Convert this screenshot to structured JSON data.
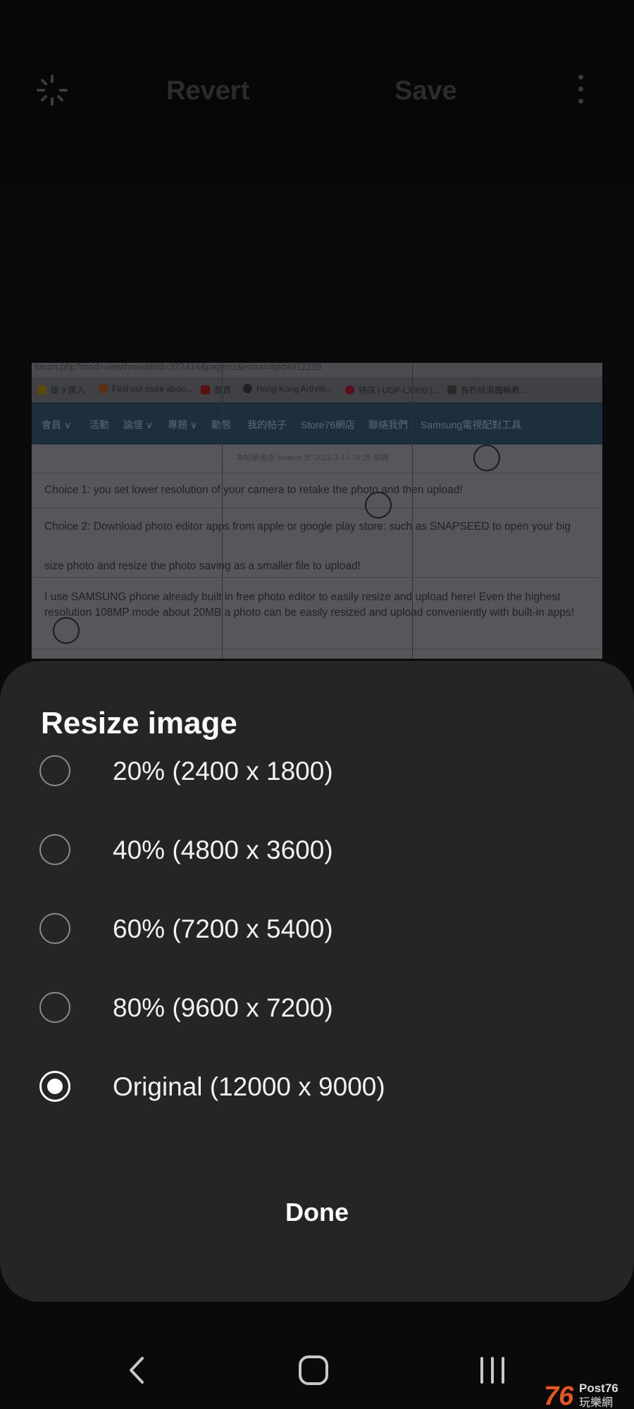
{
  "toolbar": {
    "revert_label": "Revert",
    "save_label": "Save",
    "icons": [
      "auto-adjust-icon",
      "more-options-icon"
    ]
  },
  "photo": {
    "url_text": "forum.php?mod=viewthread&tid=327414&page=1&extra=#pid4912228",
    "bookmarks": [
      "從 Ii 匯入",
      "Find out more abou...",
      "首頁",
      "Hong Kong Arthriti...",
      "特店 | UDP-LX800 |...",
      "有冇除濕機輸教..."
    ],
    "nav_items": [
      "會員 ∨",
      "活動",
      "論壇 ∨",
      "專題 ∨",
      "動態",
      "我的帖子",
      "Store76網店",
      "聯絡我們",
      "Samsung電視配對工具"
    ],
    "post_meta": "本帖最後由 amiene 於 2021-3-14 18:29 編輯",
    "post_lines": [
      "Choice 1: you set lower resolution of your camera to retake the photo and then upload!",
      "Choice 2: Download photo editor apps from apple or google play store: such as SNAPSEED to open your big",
      "size photo and resize the photo saving as a smaller file to upload!",
      "I use SAMSUNG phone already built in free photo editor to easily resize and upload here! Even the highest",
      "resolution 108MP mode about 20MB a photo can be easily resized and upload conveniently with built-in apps!"
    ]
  },
  "sheet": {
    "title": "Resize image",
    "options": [
      {
        "label": "20% (2400 x 1800)",
        "selected": false
      },
      {
        "label": "40% (4800 x 3600)",
        "selected": false
      },
      {
        "label": "60% (7200 x 5400)",
        "selected": false
      },
      {
        "label": "80% (9600 x 7200)",
        "selected": false
      },
      {
        "label": "Original (12000 x 9000)",
        "selected": true
      }
    ],
    "done_label": "Done"
  },
  "navbar": {
    "icons": [
      "back-icon",
      "home-icon",
      "recent-apps-icon"
    ]
  },
  "watermark": {
    "text": "76 Post76 玩樂網"
  },
  "colors": {
    "background": "#0a0a0a",
    "sheet": "#252525",
    "text": "#ffffff",
    "radio_unchecked": "#8a8a8a"
  }
}
